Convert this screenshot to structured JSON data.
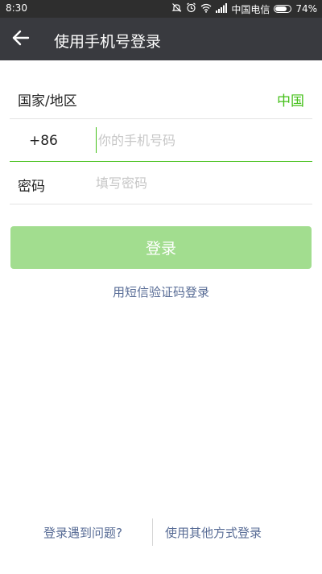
{
  "status_bar": {
    "time": "8:30",
    "carrier": "中国电信",
    "battery_text": "74%",
    "battery_level": 0.74,
    "icons": [
      "alarm-off-icon",
      "alarm-clock-icon",
      "wifi-icon",
      "signal-icon",
      "battery-icon"
    ]
  },
  "app_bar": {
    "title": "使用手机号登录",
    "back_icon": "back-arrow-icon"
  },
  "form": {
    "region_label": "国家/地区",
    "region_value": "中国",
    "country_code": "+86",
    "phone_placeholder": "你的手机号码",
    "phone_value": "",
    "password_label": "密码",
    "password_placeholder": "填写密码",
    "password_value": ""
  },
  "login_button": "登录",
  "sms_login_link": "用短信验证码登录",
  "footer": {
    "problem_link": "登录遇到问题?",
    "other_methods_link": "使用其他方式登录"
  },
  "colors": {
    "accent_green": "#45c01a",
    "disabled_button": "#a2dd8f",
    "link_blue": "#576b95",
    "app_bar": "#393a3f",
    "status_bar": "#2e2e2e"
  }
}
